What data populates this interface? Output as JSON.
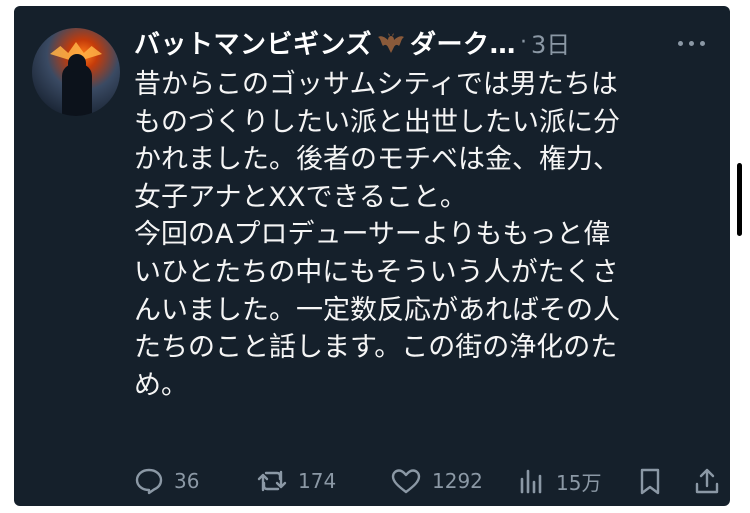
{
  "post": {
    "author_name": "バットマンビギンズ",
    "author_name_suffix": "ダーク…",
    "separator": "·",
    "time_ago": "3日",
    "body_lines": [
      "昔からこのゴッサムシティでは男たちは",
      "ものづくりしたい派と出世したい派に分",
      "かれました。後者のモチベは金、権力、",
      "女子アナとXXできること。",
      "今回のAプロデューサーよりももっと偉",
      "いひとたちの中にもそういう人がたくさ",
      "んいました。一定数反応があればその人",
      "たちのこと話します。この街の浄化のた",
      "め。"
    ]
  },
  "actions": {
    "replies": "36",
    "reposts": "174",
    "likes": "1292",
    "views": "15万"
  },
  "icons": {
    "reply": "speech-bubble-icon",
    "repost": "repost-arrows-icon",
    "like": "heart-icon",
    "views": "bar-chart-icon",
    "bookmark": "bookmark-icon",
    "share": "share-upload-icon",
    "more": "more-dots-icon",
    "emoji": "bat-emoji"
  },
  "colors": {
    "background": "#15202b",
    "text": "#f5f5f5",
    "muted": "#8b98a5"
  }
}
